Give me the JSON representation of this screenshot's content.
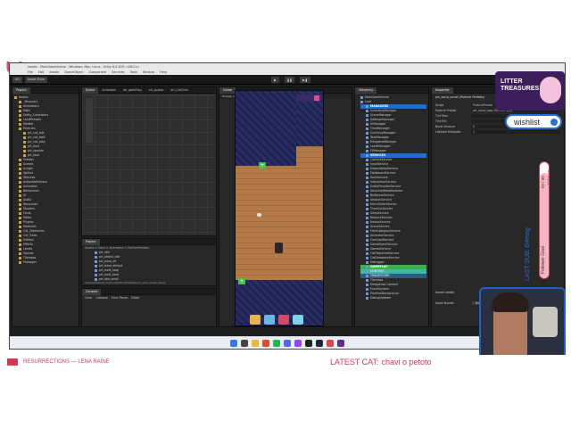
{
  "window": {
    "title": "assets - MainGameScene - Windows, Mac, Linux - Unity 6.0.30f1 <DX11>",
    "menu": [
      "File",
      "Edit",
      "Assets",
      "GameObject",
      "Component",
      "Services",
      "Tools",
      "Window",
      "Help"
    ]
  },
  "toolbar": {
    "account": "AG",
    "asset_store": "Asset Store",
    "layout": "Layout"
  },
  "project_panel": {
    "tab": "Project",
    "items": [
      "Assets",
      "_Recovery",
      "Animations",
      "Data",
      "Entity_Controllers",
      "LevelPresets",
      "Models",
      "Particles",
      "prt_cat_idle",
      "prt_cat_walk",
      "prt_cat_play",
      "prt_dust",
      "prt_sparkle",
      "prt_food",
      "Prefabs",
      "Scenes",
      "Scripts",
      "Sprites",
      "Textures",
      "ActionDefinitions",
      "Animation",
      "Behaviours",
      "UI",
      "Audio",
      "Resources",
      "Shaders",
      "Fonts",
      "Editor",
      "Plugins",
      "Materials",
      "Cat_Objectives",
      "Cat_Traits",
      "Entities",
      "Effects",
      "Levels",
      "Sounds",
      "Tilemaps",
      "Packages"
    ]
  },
  "scene_panel": {
    "tabs": [
      "Scene",
      "Animator",
      "ah_gateFlag",
      "ah_gvjoss",
      "ah_CatCtrls"
    ]
  },
  "game_panel": {
    "tab": "Game",
    "display": "Display 1",
    "resolution": "WINDOW (1080x1920)",
    "scale": "Scale",
    "fps": "0.68x"
  },
  "project_bottom": {
    "tab": "Project",
    "breadcrumb": "Assets > Data > Animation > ParticlePrefabs",
    "files": [
      "prt_idle",
      "prt_object_idle",
      "prt_pose_sit",
      "prt_base_default",
      "prt_walk_loop",
      "prt_walk_land",
      "prt_idle_small"
    ],
    "path": "Assets/Data/Animation/ParticlePrefabs/prt_sand_small.asset"
  },
  "console": {
    "tab": "Console",
    "buttons": [
      "Clear",
      "Collapse",
      "Error Pause",
      "Editor"
    ]
  },
  "hierarchy": {
    "tab": "Hierarchy",
    "items": [
      {
        "t": "MainGameScene",
        "c": ""
      },
      {
        "t": "Core",
        "c": ""
      },
      {
        "t": "MANAGERS",
        "c": "hdr-b"
      },
      {
        "t": "InventoryManager",
        "c": ""
      },
      {
        "t": "SceneManager",
        "c": ""
      },
      {
        "t": "SettingsManager",
        "c": ""
      },
      {
        "t": "UIManager",
        "c": ""
      },
      {
        "t": "TimeManager",
        "c": ""
      },
      {
        "t": "CurrencyManager",
        "c": ""
      },
      {
        "t": "TaskManager",
        "c": ""
      },
      {
        "t": "MinigameManager",
        "c": ""
      },
      {
        "t": "LevelManager",
        "c": ""
      },
      {
        "t": "FXManager",
        "c": ""
      },
      {
        "t": "SERVICES",
        "c": "hdr-b"
      },
      {
        "t": "CameraService",
        "c": ""
      },
      {
        "t": "InputService",
        "c": ""
      },
      {
        "t": "ExpandAreaService",
        "c": ""
      },
      {
        "t": "FieldboardService",
        "c": ""
      },
      {
        "t": "SaveService",
        "c": ""
      },
      {
        "t": "InteractionService",
        "c": ""
      },
      {
        "t": "EntityProviderService",
        "c": ""
      },
      {
        "t": "ValueInfoModeSelector",
        "c": ""
      },
      {
        "t": "BridleaseService",
        "c": ""
      },
      {
        "t": "SessionService",
        "c": ""
      },
      {
        "t": "MicroOrderService",
        "c": ""
      },
      {
        "t": "TimeOutService",
        "c": ""
      },
      {
        "t": "SleepService",
        "c": ""
      },
      {
        "t": "BalanceService",
        "c": ""
      },
      {
        "t": "MotionService",
        "c": ""
      },
      {
        "t": "SceneService",
        "c": ""
      },
      {
        "t": "FieldCategoryService",
        "c": ""
      },
      {
        "t": "AnimatorService",
        "c": ""
      },
      {
        "t": "OverloadService",
        "c": ""
      },
      {
        "t": "GameEventService",
        "c": ""
      },
      {
        "t": "GamesService",
        "c": ""
      },
      {
        "t": "CatObjectiveService",
        "c": ""
      },
      {
        "t": "CatDatabaseService",
        "c": ""
      },
      {
        "t": "Debugger",
        "c": ""
      },
      {
        "t": "GAMEPLAY",
        "c": "hdr-g"
      },
      {
        "t": "CONTENT",
        "c": "hdr-c"
      },
      {
        "t": "TRANSITIONS",
        "c": "sel"
      },
      {
        "t": "Tilemaps",
        "c": ""
      },
      {
        "t": "Minigames Content",
        "c": ""
      },
      {
        "t": "EventSystem",
        "c": ""
      },
      {
        "t": "ParallaxBackground",
        "c": ""
      },
      {
        "t": "DebugUpdater",
        "c": ""
      }
    ]
  },
  "inspector": {
    "tab": "Inspector",
    "object_name": "prt_sand_small (Particle Prefabs)",
    "fields": [
      {
        "label": "Script",
        "value": "ParticlePrefab"
      },
      {
        "label": "Particle Prefab",
        "value": "prt_sand_loop (Particle Sys)"
      },
      {
        "label": "Tint Max",
        "value": ""
      },
      {
        "label": "Tint Min",
        "value": ""
      },
      {
        "label": "Burst Amount",
        "value": "0"
      },
      {
        "label": "Lifetime Multiplier",
        "value": "1"
      }
    ],
    "asset_labels": "Asset Labels",
    "asset_bundle": "Asset Bundle",
    "none": "None"
  },
  "overlay": {
    "wishlist": "wishlist",
    "last_sub_label": "LAST SUB:",
    "last_sub_value": "B4mag",
    "follower_goal": "Follower Goal",
    "follower_count": "82 / 90",
    "followers": "Followers",
    "song": "RESURRECTIONS — LENA RAINE",
    "latest_cat_label": "LATEST CAT:",
    "latest_cat_value": "chavi o petoto",
    "litter_title": "LITTER TREASURES"
  },
  "colors": {
    "accent": "#d23855",
    "blue": "#1d5fd0"
  }
}
